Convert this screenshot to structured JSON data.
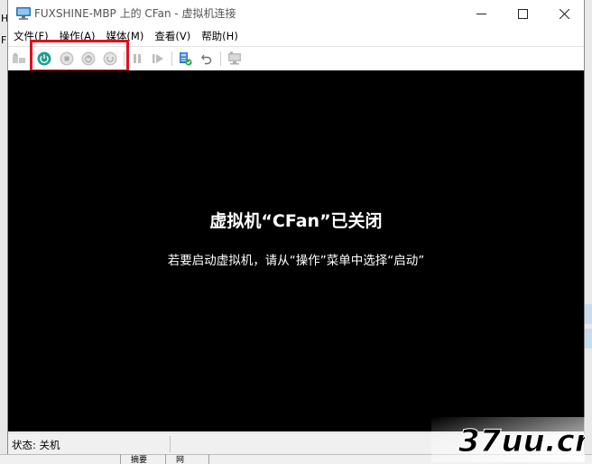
{
  "window": {
    "title": "FUXSHINE-MBP 上的 CFan - 虚拟机连接"
  },
  "menu": [
    {
      "label": "文件(F)"
    },
    {
      "label": "操作(A)"
    },
    {
      "label": "媒体(M)"
    },
    {
      "label": "查看(V)"
    },
    {
      "label": "帮助(H)"
    }
  ],
  "toolbar": {
    "icons": [
      "ctrl-alt-del-icon",
      "start-icon",
      "turn-off-icon",
      "shutdown-icon",
      "save-icon",
      "pause-icon",
      "resume-icon",
      "checkpoint-icon",
      "revert-icon",
      "enhanced-session-icon"
    ],
    "accent_color": "#1f9e8f",
    "highlight_color": "#e0101c"
  },
  "screen": {
    "title": "虚拟机“CFan”已关闭",
    "subtitle": "若要启动虚拟机，请从“操作”菜单中选择“启动”"
  },
  "status": {
    "text": "状态: 关机"
  },
  "background": {
    "left_letters": [
      "H",
      "F"
    ],
    "bottom_tab": "摘要",
    "bottom_tab_2": "网"
  },
  "watermark": {
    "text": "37uu.cn"
  }
}
